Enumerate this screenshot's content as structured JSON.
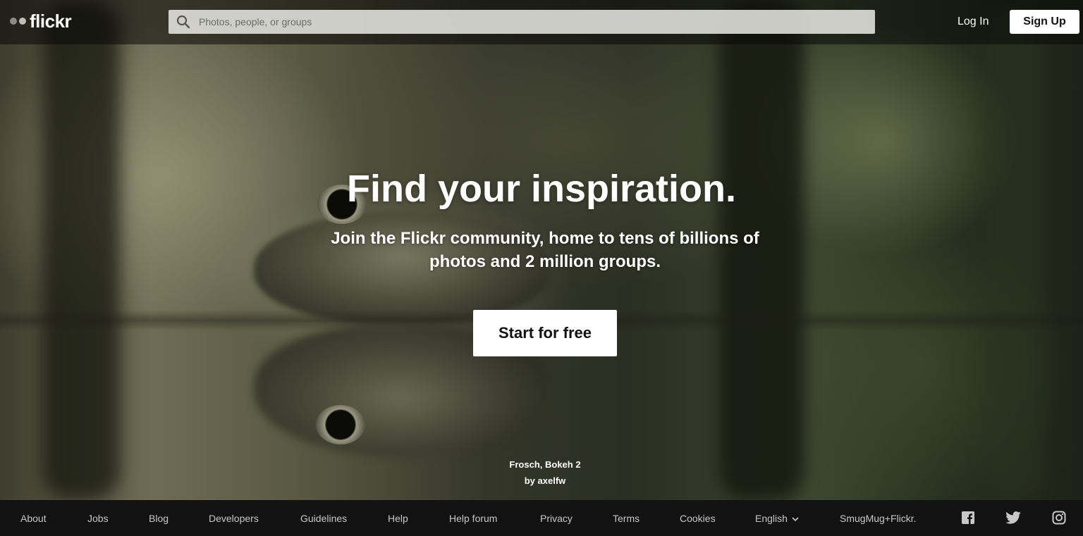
{
  "header": {
    "logo_text": "flickr",
    "search": {
      "placeholder": "Photos, people, or groups",
      "icon": "search-icon"
    },
    "login_label": "Log In",
    "signup_label": "Sign Up"
  },
  "hero": {
    "title": "Find your inspiration.",
    "subtitle": "Join the Flickr community, home to tens of billions of photos and 2 million groups.",
    "cta_label": "Start for free",
    "photo_title": "Frosch, Bokeh 2",
    "photo_author": "by axelfw"
  },
  "footer": {
    "links": [
      {
        "label": "About"
      },
      {
        "label": "Jobs"
      },
      {
        "label": "Blog"
      },
      {
        "label": "Developers"
      },
      {
        "label": "Guidelines"
      },
      {
        "label": "Help"
      },
      {
        "label": "Help forum"
      },
      {
        "label": "Privacy"
      },
      {
        "label": "Terms"
      },
      {
        "label": "Cookies"
      }
    ],
    "language": "English",
    "smugmug": "SmugMug+Flickr.",
    "social": [
      "facebook-icon",
      "twitter-icon",
      "instagram-icon"
    ]
  },
  "colors": {
    "header_bg": "#0a0a08",
    "footer_bg": "#121212",
    "footer_text": "#c8c8c8",
    "logo_dot_dark": "#8a8a8a",
    "logo_dot_light": "#bdbdbd"
  }
}
